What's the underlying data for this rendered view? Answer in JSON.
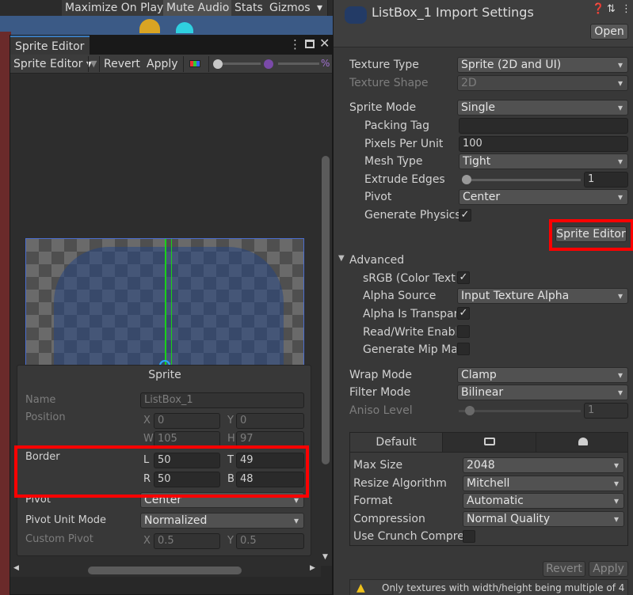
{
  "game_toolbar": {
    "maximize": "Maximize On Play",
    "mute": "Mute Audio",
    "stats": "Stats",
    "gizmos": "Gizmos"
  },
  "sprite_editor": {
    "tab": "Sprite Editor",
    "mode_dropdown": "Sprite Editor",
    "revert": "Revert",
    "apply": "Apply",
    "panel": {
      "title": "Sprite",
      "name_label": "Name",
      "name_value": "ListBox_1",
      "position_label": "Position",
      "x_label": "X",
      "x_value": "0",
      "y_label": "Y",
      "y_value": "0",
      "w_label": "W",
      "w_value": "105",
      "h_label": "H",
      "h_value": "97",
      "border_label": "Border",
      "l_label": "L",
      "l_value": "50",
      "t_label": "T",
      "t_value": "49",
      "r_label": "R",
      "r_value": "50",
      "b_label": "B",
      "b_value": "48",
      "pivot_label": "Pivot",
      "pivot_value": "Center",
      "pivot_unit_label": "Pivot Unit Mode",
      "pivot_unit_value": "Normalized",
      "custom_pivot_label": "Custom Pivot",
      "cx_label": "X",
      "cx_value": "0.5",
      "cy_label": "Y",
      "cy_value": "0.5"
    }
  },
  "inspector": {
    "title": "ListBox_1 Import Settings",
    "open": "Open",
    "texture_type_label": "Texture Type",
    "texture_type_value": "Sprite (2D and UI)",
    "texture_shape_label": "Texture Shape",
    "texture_shape_value": "2D",
    "sprite_mode_label": "Sprite Mode",
    "sprite_mode_value": "Single",
    "packing_tag_label": "Packing Tag",
    "packing_tag_value": "",
    "ppu_label": "Pixels Per Unit",
    "ppu_value": "100",
    "mesh_type_label": "Mesh Type",
    "mesh_type_value": "Tight",
    "extrude_label": "Extrude Edges",
    "extrude_value": "1",
    "pivot_label": "Pivot",
    "pivot_value": "Center",
    "gen_physics_label": "Generate Physics",
    "sprite_editor_button": "Sprite Editor",
    "advanced_label": "Advanced",
    "srgb_label": "sRGB (Color Textu",
    "alpha_source_label": "Alpha Source",
    "alpha_source_value": "Input Texture Alpha",
    "alpha_transparency_label": "Alpha Is Transpare",
    "read_write_label": "Read/Write Enable",
    "mipmap_label": "Generate Mip Map",
    "wrap_label": "Wrap Mode",
    "wrap_value": "Clamp",
    "filter_label": "Filter Mode",
    "filter_value": "Bilinear",
    "aniso_label": "Aniso Level",
    "aniso_value": "1",
    "platform_default": "Default",
    "max_size_label": "Max Size",
    "max_size_value": "2048",
    "resize_label": "Resize Algorithm",
    "resize_value": "Mitchell",
    "format_label": "Format",
    "format_value": "Automatic",
    "compression_label": "Compression",
    "compression_value": "Normal Quality",
    "crunch_label": "Use Crunch Compres",
    "revert": "Revert",
    "apply": "Apply",
    "warning": "Only textures with width/height being multiple of 4"
  }
}
